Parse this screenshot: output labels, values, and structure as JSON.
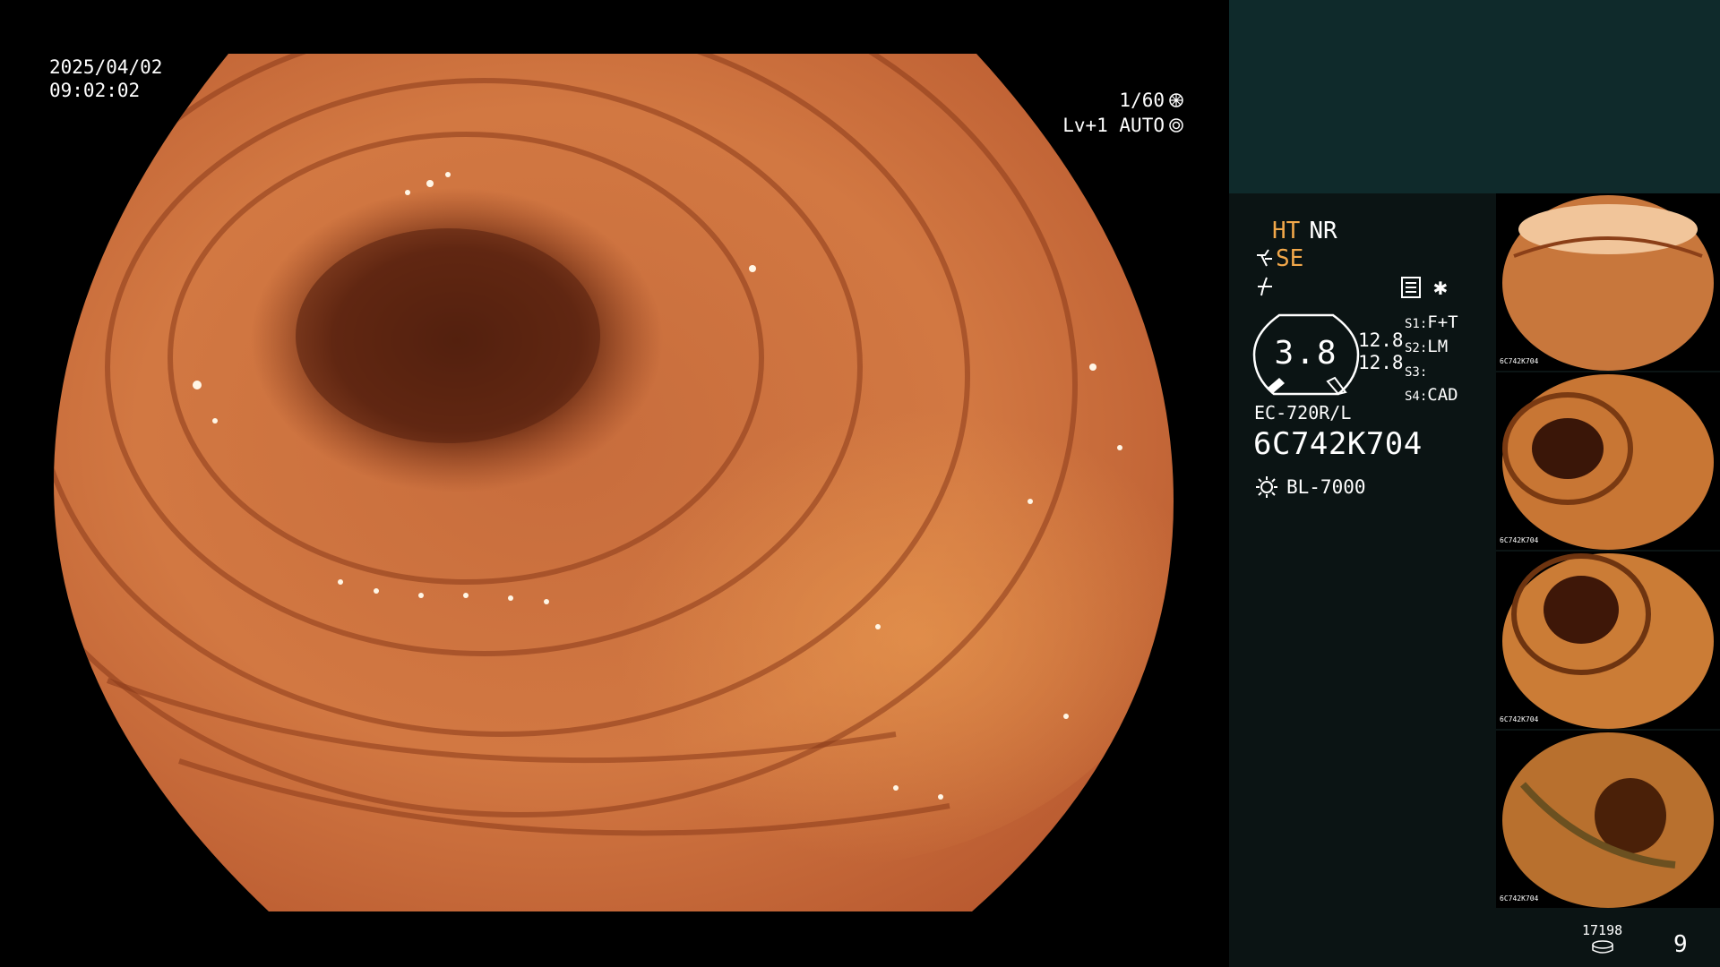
{
  "main_view": {
    "date": "2025/04/02",
    "time": "09:02:02",
    "shutter": "1/60",
    "level_auto": "Lv+1 AUTO"
  },
  "panel": {
    "status": {
      "ht": "HT",
      "nr": "NR",
      "se": "SE"
    },
    "gauge_value": "3.8",
    "levels": [
      "12.8",
      "12.8"
    ],
    "slots": [
      {
        "key": "S1:",
        "value": "F+T"
      },
      {
        "key": "S2:",
        "value": "LM"
      },
      {
        "key": "S3:",
        "value": ""
      },
      {
        "key": "S4:",
        "value": "CAD"
      }
    ],
    "scope_model": "EC-720R/L",
    "scope_serial": "6C742K704",
    "light_source": "BL-7000",
    "storage_count": "17198",
    "page_number": "9",
    "accent_color": "#f2a84a",
    "icons": [
      "star-icon",
      "sun-icon",
      "disk-icon",
      "settings-icon"
    ]
  },
  "thumbnails": [
    {
      "caption": "6C742K704"
    },
    {
      "caption": "6C742K704"
    },
    {
      "caption": "6C742K704"
    },
    {
      "caption": "6C742K704"
    }
  ]
}
